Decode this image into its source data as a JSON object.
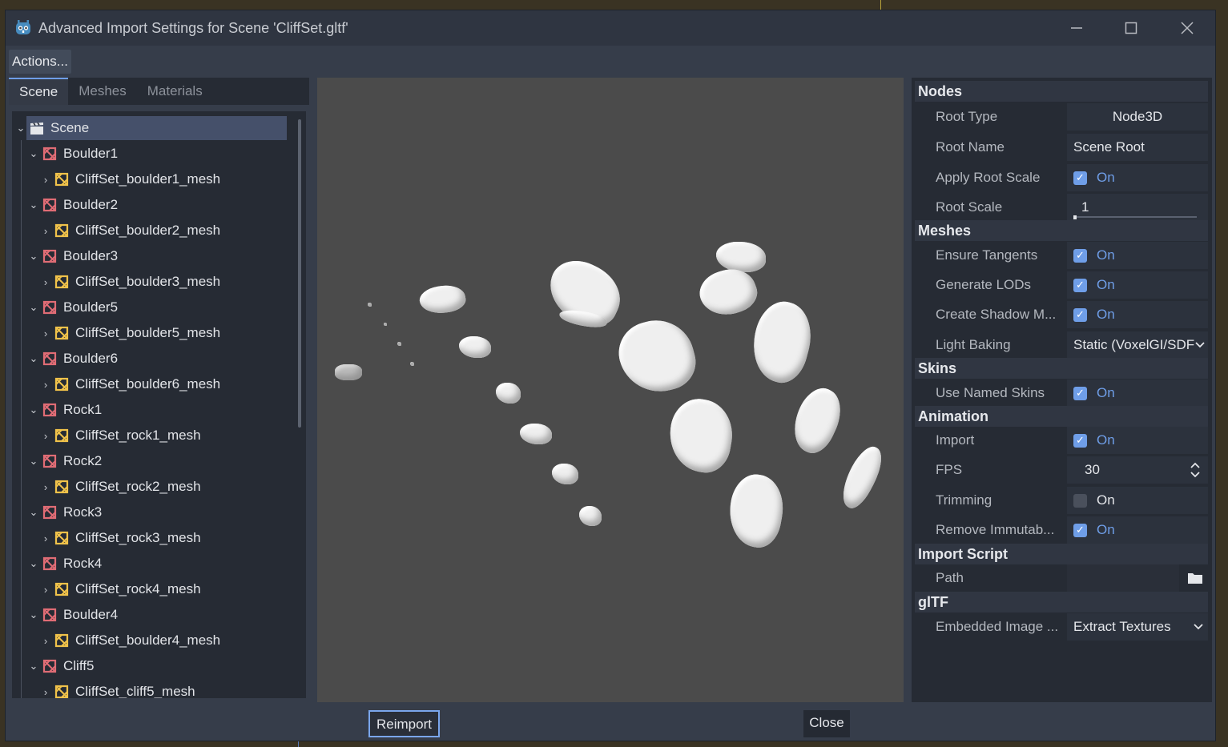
{
  "window": {
    "title": "Advanced Import Settings for Scene 'CliffSet.gltf'",
    "icons": [
      "godot-icon",
      "minimize-icon",
      "maximize-icon",
      "close-icon"
    ]
  },
  "toolbar": {
    "actions_label": "Actions..."
  },
  "tabs": [
    {
      "label": "Scene",
      "active": true
    },
    {
      "label": "Meshes",
      "active": false
    },
    {
      "label": "Materials",
      "active": false
    }
  ],
  "tree": [
    {
      "label": "Scene",
      "kind": "scene",
      "depth": 0,
      "expanded": true,
      "selected": true
    },
    {
      "label": "Boulder1",
      "kind": "node",
      "depth": 1,
      "expanded": true
    },
    {
      "label": "CliffSet_boulder1_mesh",
      "kind": "mesh",
      "depth": 2,
      "expanded": false
    },
    {
      "label": "Boulder2",
      "kind": "node",
      "depth": 1,
      "expanded": true
    },
    {
      "label": "CliffSet_boulder2_mesh",
      "kind": "mesh",
      "depth": 2,
      "expanded": false
    },
    {
      "label": "Boulder3",
      "kind": "node",
      "depth": 1,
      "expanded": true
    },
    {
      "label": "CliffSet_boulder3_mesh",
      "kind": "mesh",
      "depth": 2,
      "expanded": false
    },
    {
      "label": "Boulder5",
      "kind": "node",
      "depth": 1,
      "expanded": true
    },
    {
      "label": "CliffSet_boulder5_mesh",
      "kind": "mesh",
      "depth": 2,
      "expanded": false
    },
    {
      "label": "Boulder6",
      "kind": "node",
      "depth": 1,
      "expanded": true
    },
    {
      "label": "CliffSet_boulder6_mesh",
      "kind": "mesh",
      "depth": 2,
      "expanded": false
    },
    {
      "label": "Rock1",
      "kind": "node",
      "depth": 1,
      "expanded": true
    },
    {
      "label": "CliffSet_rock1_mesh",
      "kind": "mesh",
      "depth": 2,
      "expanded": false
    },
    {
      "label": "Rock2",
      "kind": "node",
      "depth": 1,
      "expanded": true
    },
    {
      "label": "CliffSet_rock2_mesh",
      "kind": "mesh",
      "depth": 2,
      "expanded": false
    },
    {
      "label": "Rock3",
      "kind": "node",
      "depth": 1,
      "expanded": true
    },
    {
      "label": "CliffSet_rock3_mesh",
      "kind": "mesh",
      "depth": 2,
      "expanded": false
    },
    {
      "label": "Rock4",
      "kind": "node",
      "depth": 1,
      "expanded": true
    },
    {
      "label": "CliffSet_rock4_mesh",
      "kind": "mesh",
      "depth": 2,
      "expanded": false
    },
    {
      "label": "Boulder4",
      "kind": "node",
      "depth": 1,
      "expanded": true
    },
    {
      "label": "CliffSet_boulder4_mesh",
      "kind": "mesh",
      "depth": 2,
      "expanded": false
    },
    {
      "label": "Cliff5",
      "kind": "node",
      "depth": 1,
      "expanded": true
    },
    {
      "label": "CliffSet_cliff5_mesh",
      "kind": "mesh",
      "depth": 2,
      "expanded": false
    }
  ],
  "inspector": {
    "sections": {
      "nodes": "Nodes",
      "meshes": "Meshes",
      "skins": "Skins",
      "animation": "Animation",
      "import_script": "Import Script",
      "gltf": "glTF"
    },
    "root_type": {
      "label": "Root Type",
      "value": "Node3D"
    },
    "root_name": {
      "label": "Root Name",
      "value": "Scene Root"
    },
    "apply_root_scale": {
      "label": "Apply Root Scale",
      "value": "On",
      "checked": true
    },
    "root_scale": {
      "label": "Root Scale",
      "value": "1"
    },
    "ensure_tangents": {
      "label": "Ensure Tangents",
      "value": "On",
      "checked": true
    },
    "generate_lods": {
      "label": "Generate LODs",
      "value": "On",
      "checked": true
    },
    "create_shadow": {
      "label": "Create Shadow M...",
      "value": "On",
      "checked": true
    },
    "light_baking": {
      "label": "Light Baking",
      "value": "Static (VoxelGI/SDF"
    },
    "use_named_skins": {
      "label": "Use Named Skins",
      "value": "On",
      "checked": true
    },
    "import": {
      "label": "Import",
      "value": "On",
      "checked": true
    },
    "fps": {
      "label": "FPS",
      "value": "30"
    },
    "trimming": {
      "label": "Trimming",
      "value": "On",
      "checked": false
    },
    "remove_immutable": {
      "label": "Remove Immutab...",
      "value": "On",
      "checked": true
    },
    "path": {
      "label": "Path",
      "value": ""
    },
    "embedded_image": {
      "label": "Embedded Image ...",
      "value": "Extract Textures"
    }
  },
  "footer": {
    "reimport_label": "Reimport",
    "close_label": "Close"
  },
  "colors": {
    "accent": "#6f9ee8",
    "node_icon": "#e06c75",
    "mesh_icon": "#f0c24a",
    "viewport_bg": "#4b4b4b"
  }
}
